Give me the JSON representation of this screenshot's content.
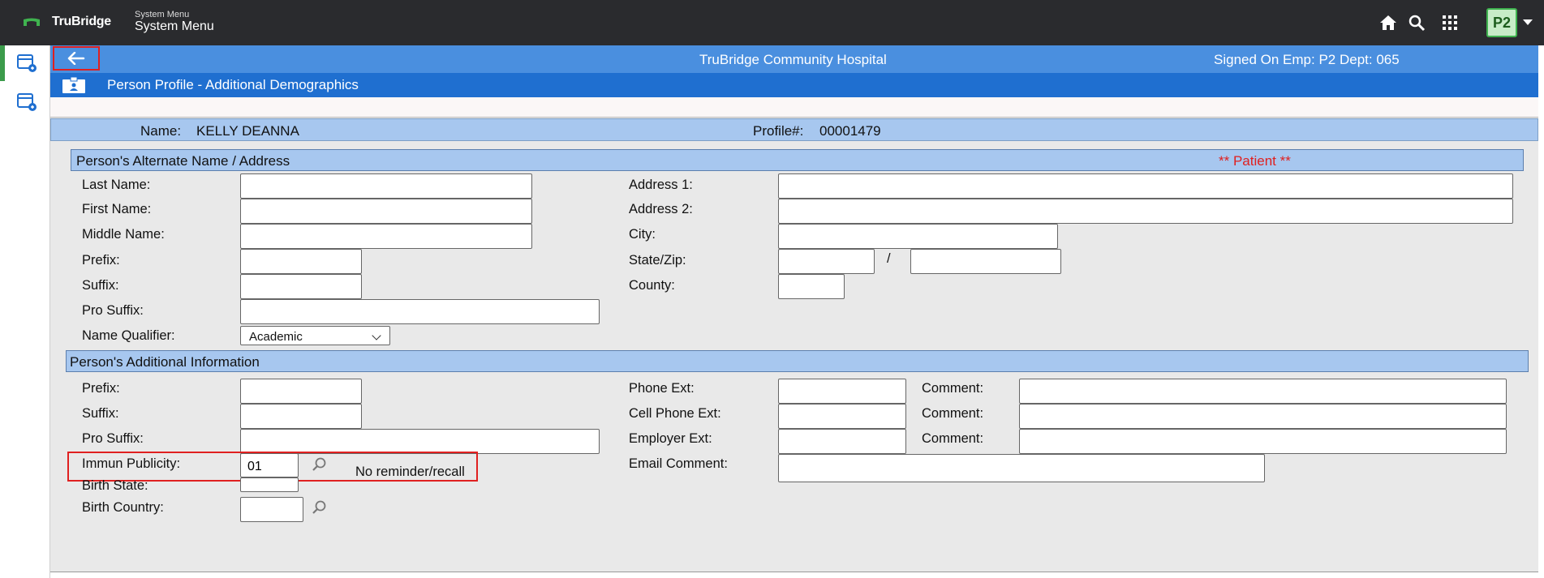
{
  "app": {
    "brand": "TruBridge",
    "menu_small": "System Menu",
    "menu_title": "System Menu",
    "user_initials": "P2"
  },
  "header": {
    "hospital": "TruBridge Community Hospital",
    "signed_on": "Signed On Emp: P2 Dept: 065",
    "page_title": "Person Profile - Additional Demographics"
  },
  "person": {
    "name_label": "Name:",
    "name_value": "KELLY DEANNA",
    "profile_label": "Profile#:",
    "profile_value": "00001479"
  },
  "alt_section": {
    "title": "Person's Alternate Name / Address",
    "patient_tag": "** Patient **",
    "last_name": {
      "label": "Last Name:",
      "value": ""
    },
    "first_name": {
      "label": "First Name:",
      "value": ""
    },
    "middle_name": {
      "label": "Middle Name:",
      "value": ""
    },
    "prefix": {
      "label": "Prefix:",
      "value": ""
    },
    "suffix": {
      "label": "Suffix:",
      "value": ""
    },
    "pro_suffix": {
      "label": "Pro Suffix:",
      "value": ""
    },
    "name_qualifier": {
      "label": "Name Qualifier:",
      "value": "Academic"
    },
    "address1": {
      "label": "Address 1:",
      "value": ""
    },
    "address2": {
      "label": "Address 2:",
      "value": ""
    },
    "city": {
      "label": "City:",
      "value": ""
    },
    "state_zip": {
      "label": "State/Zip:",
      "state": "",
      "separator": "/",
      "zip": ""
    },
    "county": {
      "label": "County:",
      "value": ""
    }
  },
  "add_section": {
    "title": "Person's Additional Information",
    "prefix": {
      "label": "Prefix:",
      "value": ""
    },
    "suffix": {
      "label": "Suffix:",
      "value": ""
    },
    "pro_suffix": {
      "label": "Pro Suffix:",
      "value": ""
    },
    "immun_publicity": {
      "label": "Immun Publicity:",
      "value": "01",
      "description": "No reminder/recall"
    },
    "birth_state": {
      "label": "Birth State:",
      "value": ""
    },
    "birth_country": {
      "label": "Birth Country:",
      "value": ""
    },
    "phone_ext": {
      "label": "Phone Ext:",
      "value": "",
      "comment_label": "Comment:",
      "comment": ""
    },
    "cell_phone_ext": {
      "label": "Cell Phone Ext:",
      "value": "",
      "comment_label": "Comment:",
      "comment": ""
    },
    "employer_ext": {
      "label": "Employer Ext:",
      "value": "",
      "comment_label": "Comment:",
      "comment": ""
    },
    "email_comment": {
      "label": "Email Comment:",
      "value": ""
    }
  },
  "colors": {
    "topbar": "#2a2b2e",
    "hospital_bar": "#4a8fdf",
    "title_bar": "#1f6fd0",
    "section_bg": "#a7c7ef",
    "accent_green": "#3fb34f",
    "highlight_red": "#e02020",
    "patient_red": "#e0201f"
  },
  "icons": [
    "trubridge-logo-icon",
    "home-icon",
    "search-icon",
    "apps-grid-icon",
    "back-arrow-icon",
    "profile-card-icon",
    "sidebar-window-icon",
    "magnify-icon"
  ]
}
